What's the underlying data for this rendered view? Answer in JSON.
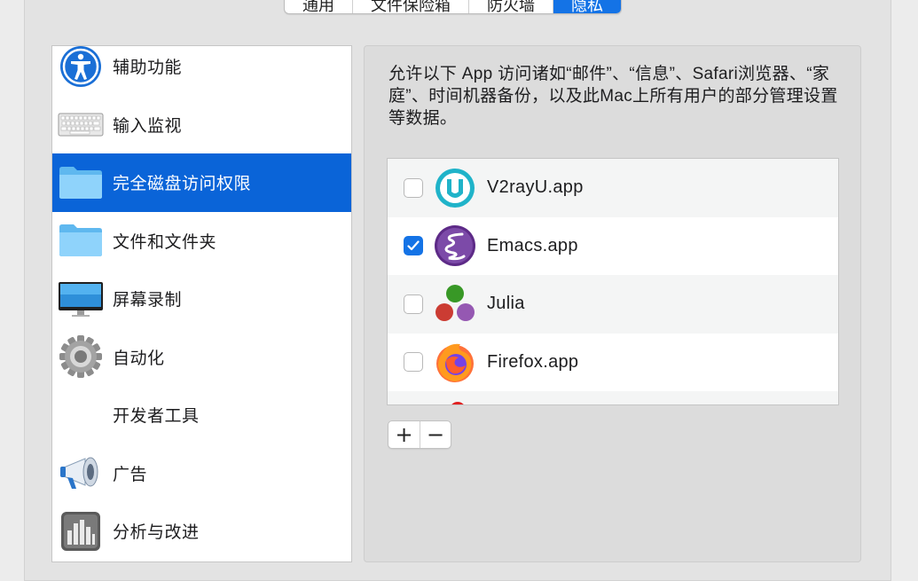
{
  "tabs": [
    {
      "label": "通用"
    },
    {
      "label": "文件保险箱"
    },
    {
      "label": "防火墙"
    },
    {
      "label": "隐私"
    }
  ],
  "sidebar": {
    "items": [
      {
        "label": "辅助功能",
        "icon": "accessibility-icon"
      },
      {
        "label": "输入监视",
        "icon": "keyboard-icon"
      },
      {
        "label": "完全磁盘访问权限",
        "icon": "folder-icon"
      },
      {
        "label": "文件和文件夹",
        "icon": "folder-icon"
      },
      {
        "label": "屏幕录制",
        "icon": "display-icon"
      },
      {
        "label": "自动化",
        "icon": "gear-icon"
      },
      {
        "label": "开发者工具",
        "icon": ""
      },
      {
        "label": "广告",
        "icon": "megaphone-icon"
      },
      {
        "label": "分析与改进",
        "icon": "bar-chart-icon"
      }
    ],
    "selected_index": 2
  },
  "content": {
    "description": "允许以下 App 访问诸如“邮件”、“信息”、Safari浏览器、“家庭”、时间机器备份，以及此Mac上所有用户的部分管理设置等数据。",
    "apps": [
      {
        "name": "V2rayU.app",
        "checked": false,
        "icon": "v2rayu-icon"
      },
      {
        "name": "Emacs.app",
        "checked": true,
        "icon": "emacs-icon"
      },
      {
        "name": "Julia",
        "checked": false,
        "icon": "julia-icon"
      },
      {
        "name": "Firefox.app",
        "checked": false,
        "icon": "firefox-icon"
      }
    ],
    "add_label": "+",
    "remove_label": "−"
  },
  "colors": {
    "accent": "#1473e6",
    "selection": "#0a64d8"
  }
}
